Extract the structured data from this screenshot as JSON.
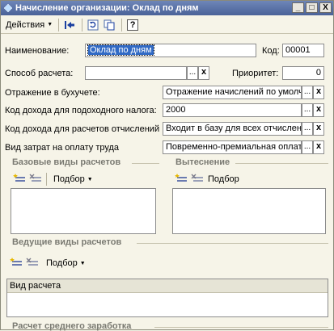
{
  "window": {
    "title": "Начисление организации: Оклад по дням",
    "buttons": [
      "_",
      "□",
      "X"
    ]
  },
  "toolbar": {
    "actions_label": "Действия",
    "icons": [
      "arrow-left-icon",
      "refresh-icon",
      "copy-icon",
      "help-icon"
    ],
    "help_glyph": "?"
  },
  "form": {
    "name_label": "Наименование:",
    "name_value": "Оклад по дням",
    "code_label": "Код:",
    "code_value": "00001",
    "method_label": "Способ расчета:",
    "method_value": "",
    "priority_label": "Приоритет:",
    "priority_value": "0",
    "accounting_label": "Отражение в бухучете:",
    "accounting_value": "Отражение начислений по умолча",
    "income_code_label": "Код дохода для подоходного налога:",
    "income_code_value": "2000",
    "deduction_code_label": "Код дохода для расчетов отчислений...",
    "deduction_code_value": "Входит в базу для всех отчислени",
    "cost_type_label": "Вид затрат на оплату труда",
    "cost_type_value": "Повременно-премиальная оплата"
  },
  "sections": {
    "base": {
      "title": "Базовые виды расчетов",
      "pick_label": "Подбор"
    },
    "displace": {
      "title": "Вытеснение",
      "pick_label": "Подбор"
    },
    "leading": {
      "title": "Ведущие виды расчетов",
      "pick_label": "Подбор",
      "column_header": "Вид расчета"
    },
    "average": {
      "title": "Расчет среднего заработка"
    }
  },
  "button_glyphs": {
    "ellipsis": "...",
    "clear": "x"
  }
}
